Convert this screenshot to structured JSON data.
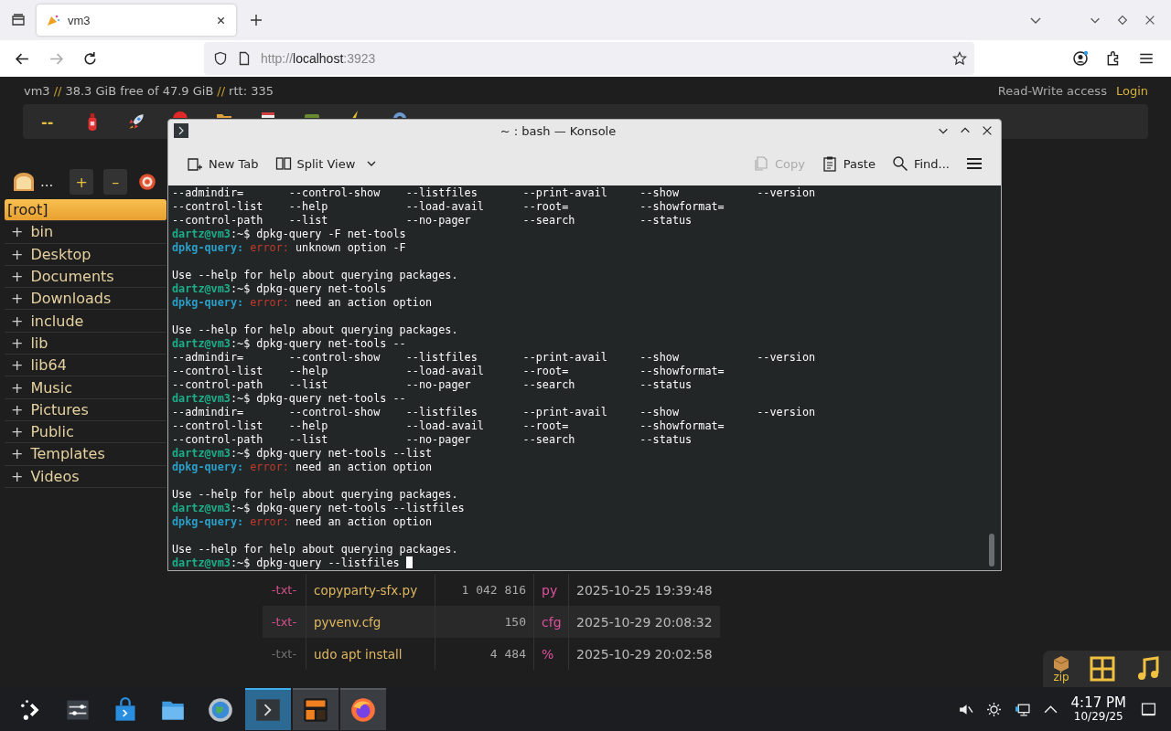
{
  "browser": {
    "tab": {
      "title": "vm3",
      "selected": true
    },
    "url": {
      "scheme": "http://",
      "host": "localhost",
      "port": ":3923"
    }
  },
  "page": {
    "status": [
      {
        "kind": "value",
        "text": "vm3"
      },
      {
        "kind": "sep",
        "text": "//"
      },
      {
        "kind": "value",
        "text": "38.3 GiB free of 47.9 GiB"
      },
      {
        "kind": "sep",
        "text": "//"
      },
      {
        "kind": "value",
        "text": "rtt: 335"
      }
    ],
    "access": "Read-Write access",
    "login": "Login",
    "toolbar_label": "--",
    "sidebar": {
      "more": "...",
      "add": "+",
      "remove": "–"
    },
    "tree": [
      {
        "label": "[root]",
        "selected": true
      },
      {
        "toggle": "+",
        "label": "bin",
        "selected": false
      },
      {
        "toggle": "+",
        "label": "Desktop",
        "selected": false
      },
      {
        "toggle": "+",
        "label": "Documents",
        "selected": false
      },
      {
        "toggle": "+",
        "label": "Downloads",
        "selected": false
      },
      {
        "toggle": "+",
        "label": "include",
        "selected": false
      },
      {
        "toggle": "+",
        "label": "lib",
        "selected": false
      },
      {
        "toggle": "+",
        "label": "lib64",
        "selected": false
      },
      {
        "toggle": "+",
        "label": "Music",
        "selected": false
      },
      {
        "toggle": "+",
        "label": "Pictures",
        "selected": false
      },
      {
        "toggle": "+",
        "label": "Public",
        "selected": false
      },
      {
        "toggle": "+",
        "label": "Templates",
        "selected": false
      },
      {
        "toggle": "+",
        "label": "Videos",
        "selected": false
      }
    ],
    "files": [
      {
        "tag": "-txt-",
        "color": "#d0508c",
        "name": "copyparty-sfx.py",
        "size": "1 042 816",
        "ext": "py",
        "date": "2025-10-25 19:39:48"
      },
      {
        "tag": "-txt-",
        "color": "#d0508c",
        "name": "pyvenv.cfg",
        "size": "150",
        "ext": "cfg",
        "date": "2025-10-29 20:08:32"
      },
      {
        "tag": "-txt-",
        "color": "#707070",
        "name": "udo apt install",
        "size": "4 484",
        "ext": "%",
        "date": "2025-10-29 20:02:58"
      }
    ],
    "dock": {
      "zip": "zip"
    }
  },
  "konsole": {
    "title": "~ : bash — Konsole",
    "toolbar": [
      {
        "kind": "new-tab",
        "label": "New Tab",
        "disabled": false
      },
      {
        "kind": "split-view",
        "label": "Split View",
        "disabled": false
      },
      {
        "kind": "copy",
        "label": "Copy",
        "disabled": true
      },
      {
        "kind": "paste",
        "label": "Paste",
        "disabled": false
      },
      {
        "kind": "find",
        "label": "Find...",
        "disabled": false
      },
      {
        "kind": "menu",
        "disabled": false
      }
    ],
    "lines": [
      {
        "kind": "output",
        "text": "--admindir=       --control-show    --listfiles       --print-avail     --show            --version"
      },
      {
        "kind": "output",
        "text": "--control-list    --help            --load-avail      --root=           --showformat="
      },
      {
        "kind": "output",
        "text": "--control-path    --list            --no-pager        --search          --status"
      },
      {
        "kind": "prompt",
        "user": "dartz@vm3",
        "text": ":~$ dpkg-query -F net-tools"
      },
      {
        "kind": "error",
        "program": "dpkg-query:",
        "label": "error:",
        "text": "unknown option -F"
      },
      {
        "kind": "blank"
      },
      {
        "kind": "output",
        "text": "Use --help for help about querying packages."
      },
      {
        "kind": "prompt",
        "user": "dartz@vm3",
        "text": ":~$ dpkg-query net-tools"
      },
      {
        "kind": "error",
        "program": "dpkg-query:",
        "label": "error:",
        "text": "need an action option"
      },
      {
        "kind": "blank"
      },
      {
        "kind": "output",
        "text": "Use --help for help about querying packages."
      },
      {
        "kind": "prompt",
        "user": "dartz@vm3",
        "text": ":~$ dpkg-query net-tools --"
      },
      {
        "kind": "output",
        "text": "--admindir=       --control-show    --listfiles       --print-avail     --show            --version"
      },
      {
        "kind": "output",
        "text": "--control-list    --help            --load-avail      --root=           --showformat="
      },
      {
        "kind": "output",
        "text": "--control-path    --list            --no-pager        --search          --status"
      },
      {
        "kind": "prompt",
        "user": "dartz@vm3",
        "text": ":~$ dpkg-query net-tools --"
      },
      {
        "kind": "output",
        "text": "--admindir=       --control-show    --listfiles       --print-avail     --show            --version"
      },
      {
        "kind": "output",
        "text": "--control-list    --help            --load-avail      --root=           --showformat="
      },
      {
        "kind": "output",
        "text": "--control-path    --list            --no-pager        --search          --status"
      },
      {
        "kind": "prompt",
        "user": "dartz@vm3",
        "text": ":~$ dpkg-query net-tools --list"
      },
      {
        "kind": "error",
        "program": "dpkg-query:",
        "label": "error:",
        "text": "need an action option"
      },
      {
        "kind": "blank"
      },
      {
        "kind": "output",
        "text": "Use --help for help about querying packages."
      },
      {
        "kind": "prompt",
        "user": "dartz@vm3",
        "text": ":~$ dpkg-query net-tools --listfiles"
      },
      {
        "kind": "error",
        "program": "dpkg-query:",
        "label": "error:",
        "text": "need an action option"
      },
      {
        "kind": "blank"
      },
      {
        "kind": "output",
        "text": "Use --help for help about querying packages."
      },
      {
        "kind": "prompt",
        "user": "dartz@vm3",
        "text": ":~$ dpkg-query --listfiles ",
        "cursor": true
      }
    ]
  },
  "taskbar": {
    "items": [
      {
        "kind": "launcher",
        "running": false,
        "selected": false
      },
      {
        "kind": "settings",
        "running": false,
        "selected": false
      },
      {
        "kind": "store",
        "running": false,
        "selected": false
      },
      {
        "kind": "files",
        "running": false,
        "selected": false
      },
      {
        "kind": "globe",
        "running": false,
        "selected": false
      },
      {
        "kind": "konsole",
        "running": true,
        "selected": true
      },
      {
        "kind": "crt",
        "running": true,
        "selected": false
      },
      {
        "kind": "firefox",
        "running": true,
        "selected": false
      }
    ],
    "clock": {
      "time": "4:17 PM",
      "date": "10/29/25"
    }
  }
}
